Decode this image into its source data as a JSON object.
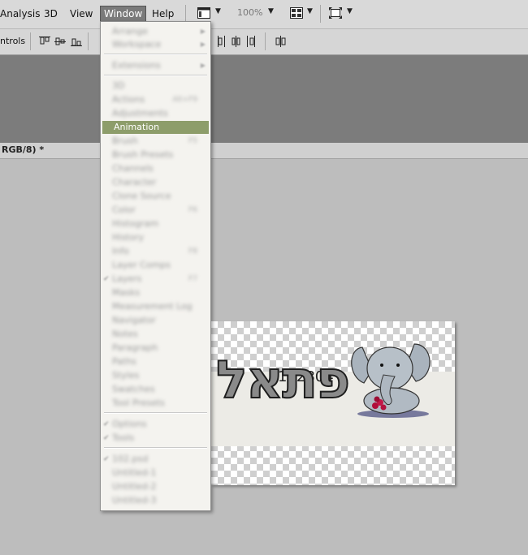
{
  "menubar": {
    "items": [
      {
        "label": "Analysis"
      },
      {
        "label": "3D"
      },
      {
        "label": "View"
      },
      {
        "label": "Window"
      },
      {
        "label": "Help"
      }
    ],
    "zoom": "100%",
    "icons": [
      "screen-mode-icon",
      "arrange-documents-icon",
      "fullscreen-icon"
    ]
  },
  "options_bar": {
    "label": "ntrols"
  },
  "document": {
    "tab_title": "RGB/8) *"
  },
  "canvas_art": {
    "number": "102804",
    "text": "פתאל"
  },
  "window_menu": {
    "items": [
      {
        "label": "Arrange",
        "blurred": true,
        "submenu": true
      },
      {
        "label": "Workspace",
        "blurred": true,
        "submenu": true
      },
      {
        "label": "Extensions",
        "blurred": true,
        "submenu": true
      },
      {
        "label": "3D",
        "blurred": true
      },
      {
        "label": "Actions",
        "shortcut": "Alt+F9",
        "blurred": true
      },
      {
        "label": "Adjustments",
        "blurred": true
      },
      {
        "label": "Animation",
        "highlighted": true
      },
      {
        "label": "Brush",
        "shortcut": "F5",
        "blurred": true
      },
      {
        "label": "Brush Presets",
        "blurred": true
      },
      {
        "label": "Channels",
        "blurred": true
      },
      {
        "label": "Character",
        "blurred": true
      },
      {
        "label": "Clone Source",
        "blurred": true
      },
      {
        "label": "Color",
        "shortcut": "F6",
        "blurred": true
      },
      {
        "label": "Histogram",
        "blurred": true
      },
      {
        "label": "History",
        "blurred": true
      },
      {
        "label": "Info",
        "shortcut": "F8",
        "blurred": true
      },
      {
        "label": "Layer Comps",
        "blurred": true
      },
      {
        "label": "Layers",
        "shortcut": "F7",
        "checked": true,
        "blurred": true
      },
      {
        "label": "Masks",
        "blurred": true
      },
      {
        "label": "Measurement Log",
        "blurred": true
      },
      {
        "label": "Navigator",
        "blurred": true
      },
      {
        "label": "Notes",
        "blurred": true
      },
      {
        "label": "Paragraph",
        "blurred": true
      },
      {
        "label": "Paths",
        "blurred": true
      },
      {
        "label": "Styles",
        "blurred": true
      },
      {
        "label": "Swatches",
        "blurred": true
      },
      {
        "label": "Tool Presets",
        "blurred": true
      },
      {
        "label": "Options",
        "checked": true,
        "blurred": true
      },
      {
        "label": "Tools",
        "checked": true,
        "blurred": true
      },
      {
        "label": "102.psd",
        "checked": true,
        "blurred": true
      },
      {
        "label": "Untitled-1",
        "blurred": true
      },
      {
        "label": "Untitled-2",
        "blurred": true
      },
      {
        "label": "Untitled-3",
        "blurred": true
      }
    ]
  }
}
